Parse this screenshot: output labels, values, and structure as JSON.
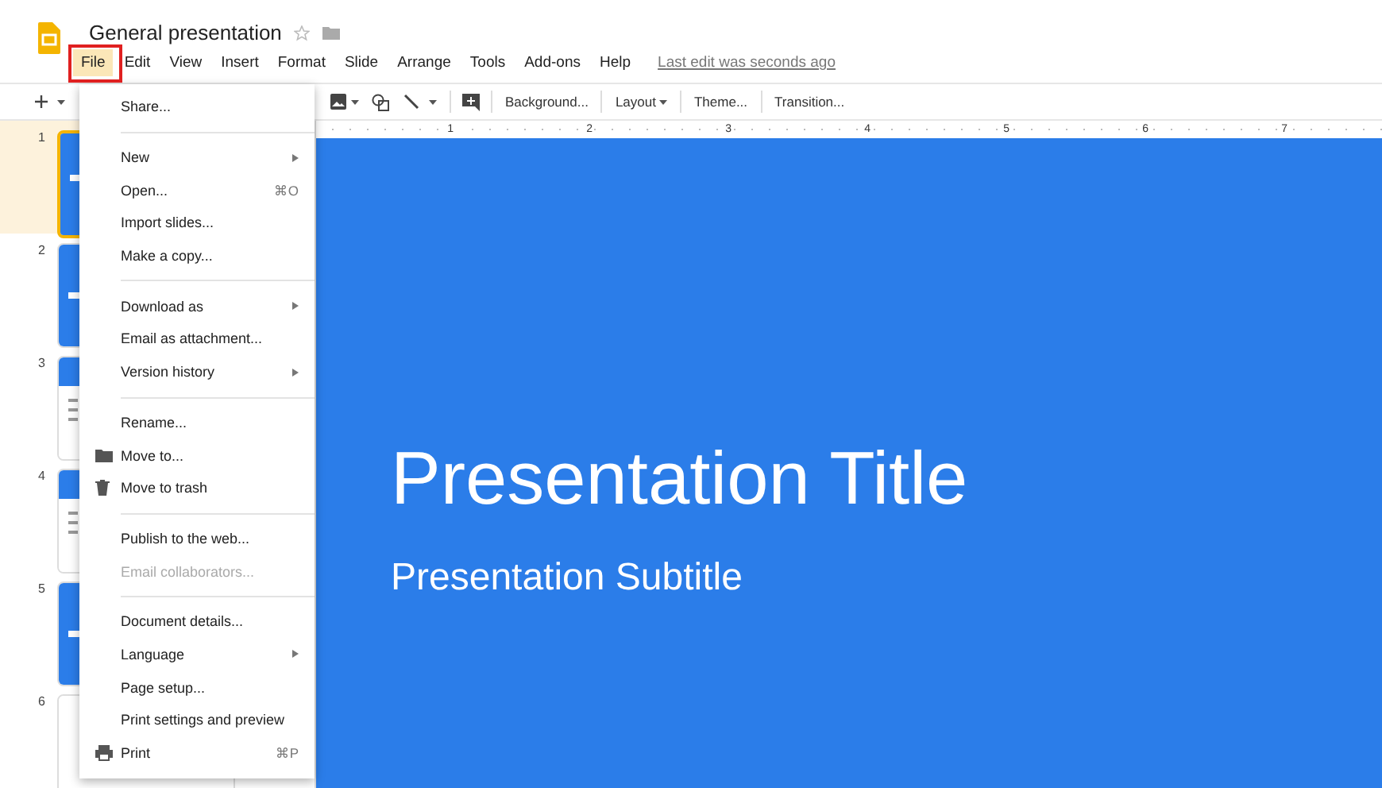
{
  "document": {
    "title": "General presentation",
    "starred": false,
    "last_edit": "Last edit was seconds ago"
  },
  "menubar": [
    {
      "label": "File",
      "selected": true
    },
    {
      "label": "Edit",
      "selected": false
    },
    {
      "label": "View",
      "selected": false
    },
    {
      "label": "Insert",
      "selected": false
    },
    {
      "label": "Format",
      "selected": false
    },
    {
      "label": "Slide",
      "selected": false
    },
    {
      "label": "Arrange",
      "selected": false
    },
    {
      "label": "Tools",
      "selected": false
    },
    {
      "label": "Add-ons",
      "selected": false
    },
    {
      "label": "Help",
      "selected": false
    }
  ],
  "toolbar": {
    "text_buttons": [
      {
        "label": "Background...",
        "has_caret": false
      },
      {
        "label": "Layout",
        "has_caret": true
      },
      {
        "label": "Theme...",
        "has_caret": false
      },
      {
        "label": "Transition...",
        "has_caret": false
      }
    ]
  },
  "ruler": [
    "1",
    "2",
    "3",
    "4",
    "5",
    "6",
    "7"
  ],
  "filmstrip": [
    {
      "number": "1",
      "selected": true,
      "kind": "title"
    },
    {
      "number": "2",
      "selected": false,
      "kind": "section"
    },
    {
      "number": "3",
      "selected": false,
      "kind": "content"
    },
    {
      "number": "4",
      "selected": false,
      "kind": "content"
    },
    {
      "number": "5",
      "selected": false,
      "kind": "section"
    },
    {
      "number": "6",
      "selected": false,
      "kind": "blank"
    }
  ],
  "file_menu": [
    {
      "kind": "plain",
      "label": "Share...",
      "submenu": false,
      "disabled": false
    },
    {
      "kind": "separator"
    },
    {
      "kind": "plain",
      "label": "New",
      "submenu": true,
      "disabled": false
    },
    {
      "kind": "plain",
      "label": "Open...",
      "shortcut": "⌘O",
      "submenu": false,
      "disabled": false
    },
    {
      "kind": "plain",
      "label": "Import slides...",
      "submenu": false,
      "disabled": false
    },
    {
      "kind": "plain",
      "label": "Make a copy...",
      "submenu": false,
      "disabled": false
    },
    {
      "kind": "separator"
    },
    {
      "kind": "plain",
      "label": "Download as",
      "submenu": true,
      "disabled": false
    },
    {
      "kind": "plain",
      "label": "Email as attachment...",
      "submenu": false,
      "disabled": false
    },
    {
      "kind": "plain",
      "label": "Version history",
      "submenu": true,
      "disabled": false
    },
    {
      "kind": "separator"
    },
    {
      "kind": "plain",
      "label": "Rename...",
      "submenu": false,
      "disabled": false
    },
    {
      "kind": "folder",
      "label": "Move to...",
      "submenu": false,
      "disabled": false
    },
    {
      "kind": "trash",
      "label": "Move to trash",
      "submenu": false,
      "disabled": false
    },
    {
      "kind": "separator"
    },
    {
      "kind": "plain",
      "label": "Publish to the web...",
      "submenu": false,
      "disabled": false
    },
    {
      "kind": "plain",
      "label": "Email collaborators...",
      "submenu": false,
      "disabled": true
    },
    {
      "kind": "separator"
    },
    {
      "kind": "plain",
      "label": "Document details...",
      "submenu": false,
      "disabled": false
    },
    {
      "kind": "plain",
      "label": "Language",
      "submenu": true,
      "disabled": false
    },
    {
      "kind": "plain",
      "label": "Page setup...",
      "submenu": false,
      "disabled": false
    },
    {
      "kind": "plain",
      "label": "Print settings and preview",
      "submenu": false,
      "disabled": false
    },
    {
      "kind": "printer",
      "label": "Print",
      "shortcut": "⌘P",
      "submenu": false,
      "disabled": false
    }
  ],
  "slide": {
    "title": "Presentation Title",
    "subtitle": "Presentation Subtitle"
  }
}
